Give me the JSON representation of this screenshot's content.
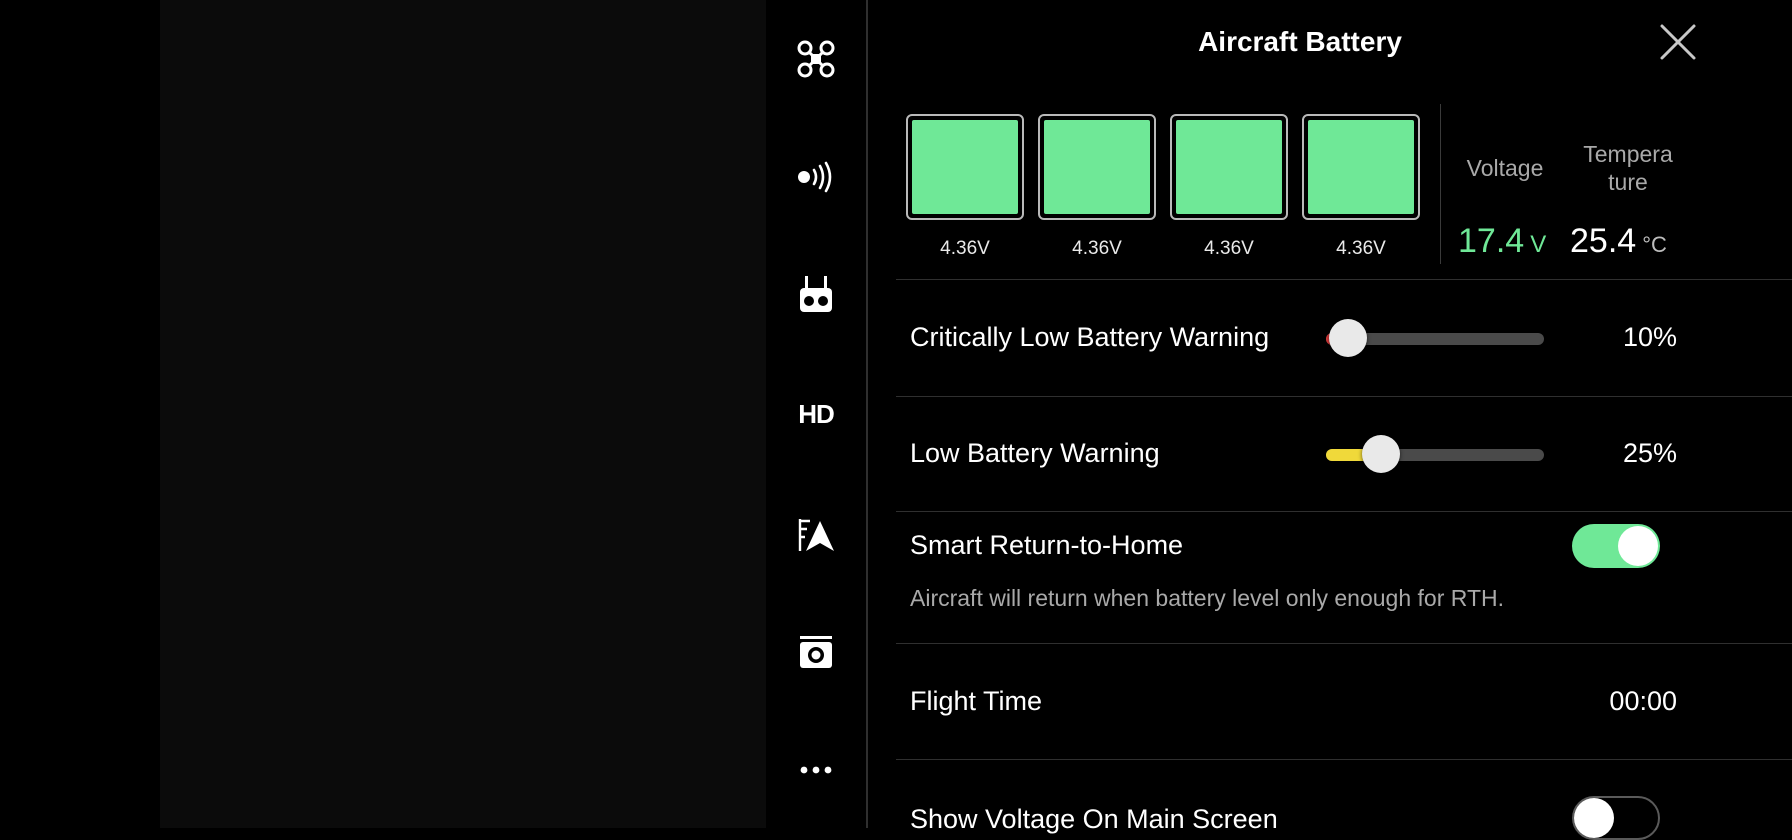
{
  "panel": {
    "title": "Aircraft Battery"
  },
  "sidebar": {
    "icons": [
      "aircraft-icon",
      "signal-icon",
      "remote-controller-icon",
      "hd-icon",
      "gps-icon",
      "camera-icon",
      "more-icon"
    ],
    "hd_label": "HD",
    "more_label": "•••"
  },
  "battery": {
    "cells": [
      {
        "voltage": "4.36V",
        "level": 1.0
      },
      {
        "voltage": "4.36V",
        "level": 1.0
      },
      {
        "voltage": "4.36V",
        "level": 1.0
      },
      {
        "voltage": "4.36V",
        "level": 1.0
      }
    ],
    "voltage_label": "Voltage",
    "voltage_value": "17.4",
    "voltage_unit": "V",
    "temperature_label_line1": "Tempera",
    "temperature_label_line2": "ture",
    "temperature_value": "25.4",
    "temperature_unit": "°C"
  },
  "settings": {
    "critical": {
      "label": "Critically Low Battery Warning",
      "value": "10%",
      "level": 0.1
    },
    "low": {
      "label": "Low Battery Warning",
      "value": "25%",
      "level": 0.25
    },
    "smart_rth": {
      "label": "Smart Return-to-Home",
      "on": true,
      "description": "Aircraft will return when battery level only enough for RTH."
    },
    "flight_time": {
      "label": "Flight Time",
      "value": "00:00"
    },
    "show_voltage": {
      "label": "Show Voltage On Main Screen",
      "on": false
    }
  },
  "colors": {
    "accent_green": "#6fe897",
    "warning_yellow": "#f0d93a",
    "track_gray": "#4a4a4a"
  }
}
